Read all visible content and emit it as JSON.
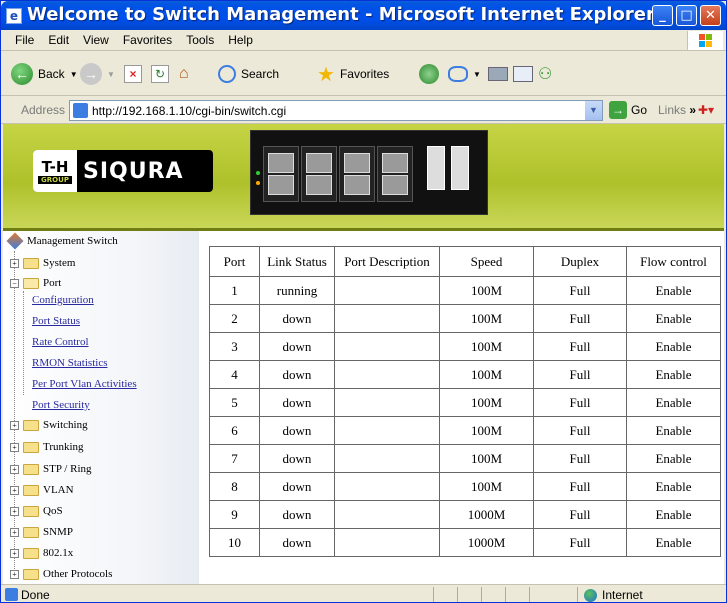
{
  "window": {
    "title": "Welcome to Switch Management - Microsoft Internet Explorer",
    "controls": [
      "minimize",
      "maximize",
      "close"
    ]
  },
  "menu": [
    "File",
    "Edit",
    "View",
    "Favorites",
    "Tools",
    "Help"
  ],
  "toolbar": {
    "back_label": "Back",
    "search_label": "Search",
    "favorites_label": "Favorites"
  },
  "address": {
    "label": "Address",
    "url": "http://192.168.1.10/cgi-bin/switch.cgi",
    "go_label": "Go",
    "links_label": "Links"
  },
  "banner": {
    "logo_tk": "T-H",
    "logo_group": "GROUP",
    "logo_brand": "SIQURA"
  },
  "sidebar": {
    "root": "Management Switch",
    "items": [
      {
        "label": "System",
        "expanded": false
      },
      {
        "label": "Port",
        "expanded": true,
        "children": [
          "Configuration",
          "Port Status",
          "Rate Control",
          "RMON Statistics",
          "Per Port Vlan Activities",
          "Port Security"
        ]
      },
      {
        "label": "Switching",
        "expanded": false
      },
      {
        "label": "Trunking",
        "expanded": false
      },
      {
        "label": "STP / Ring",
        "expanded": false
      },
      {
        "label": "VLAN",
        "expanded": false
      },
      {
        "label": "QoS",
        "expanded": false
      },
      {
        "label": "SNMP",
        "expanded": false
      },
      {
        "label": "802.1x",
        "expanded": false
      },
      {
        "label": "Other Protocols",
        "expanded": false
      }
    ]
  },
  "port_table": {
    "columns": [
      "Port",
      "Link Status",
      "Port Description",
      "Speed",
      "Duplex",
      "Flow control"
    ],
    "rows": [
      [
        "1",
        "running",
        "",
        "100M",
        "Full",
        "Enable"
      ],
      [
        "2",
        "down",
        "",
        "100M",
        "Full",
        "Enable"
      ],
      [
        "3",
        "down",
        "",
        "100M",
        "Full",
        "Enable"
      ],
      [
        "4",
        "down",
        "",
        "100M",
        "Full",
        "Enable"
      ],
      [
        "5",
        "down",
        "",
        "100M",
        "Full",
        "Enable"
      ],
      [
        "6",
        "down",
        "",
        "100M",
        "Full",
        "Enable"
      ],
      [
        "7",
        "down",
        "",
        "100M",
        "Full",
        "Enable"
      ],
      [
        "8",
        "down",
        "",
        "100M",
        "Full",
        "Enable"
      ],
      [
        "9",
        "down",
        "",
        "1000M",
        "Full",
        "Enable"
      ],
      [
        "10",
        "down",
        "",
        "1000M",
        "Full",
        "Enable"
      ]
    ]
  },
  "status": {
    "text": "Done",
    "zone": "Internet"
  },
  "colors": {
    "title_bar": "#0053e4",
    "banner": "#c6d445",
    "link": "#2a2aa0"
  }
}
